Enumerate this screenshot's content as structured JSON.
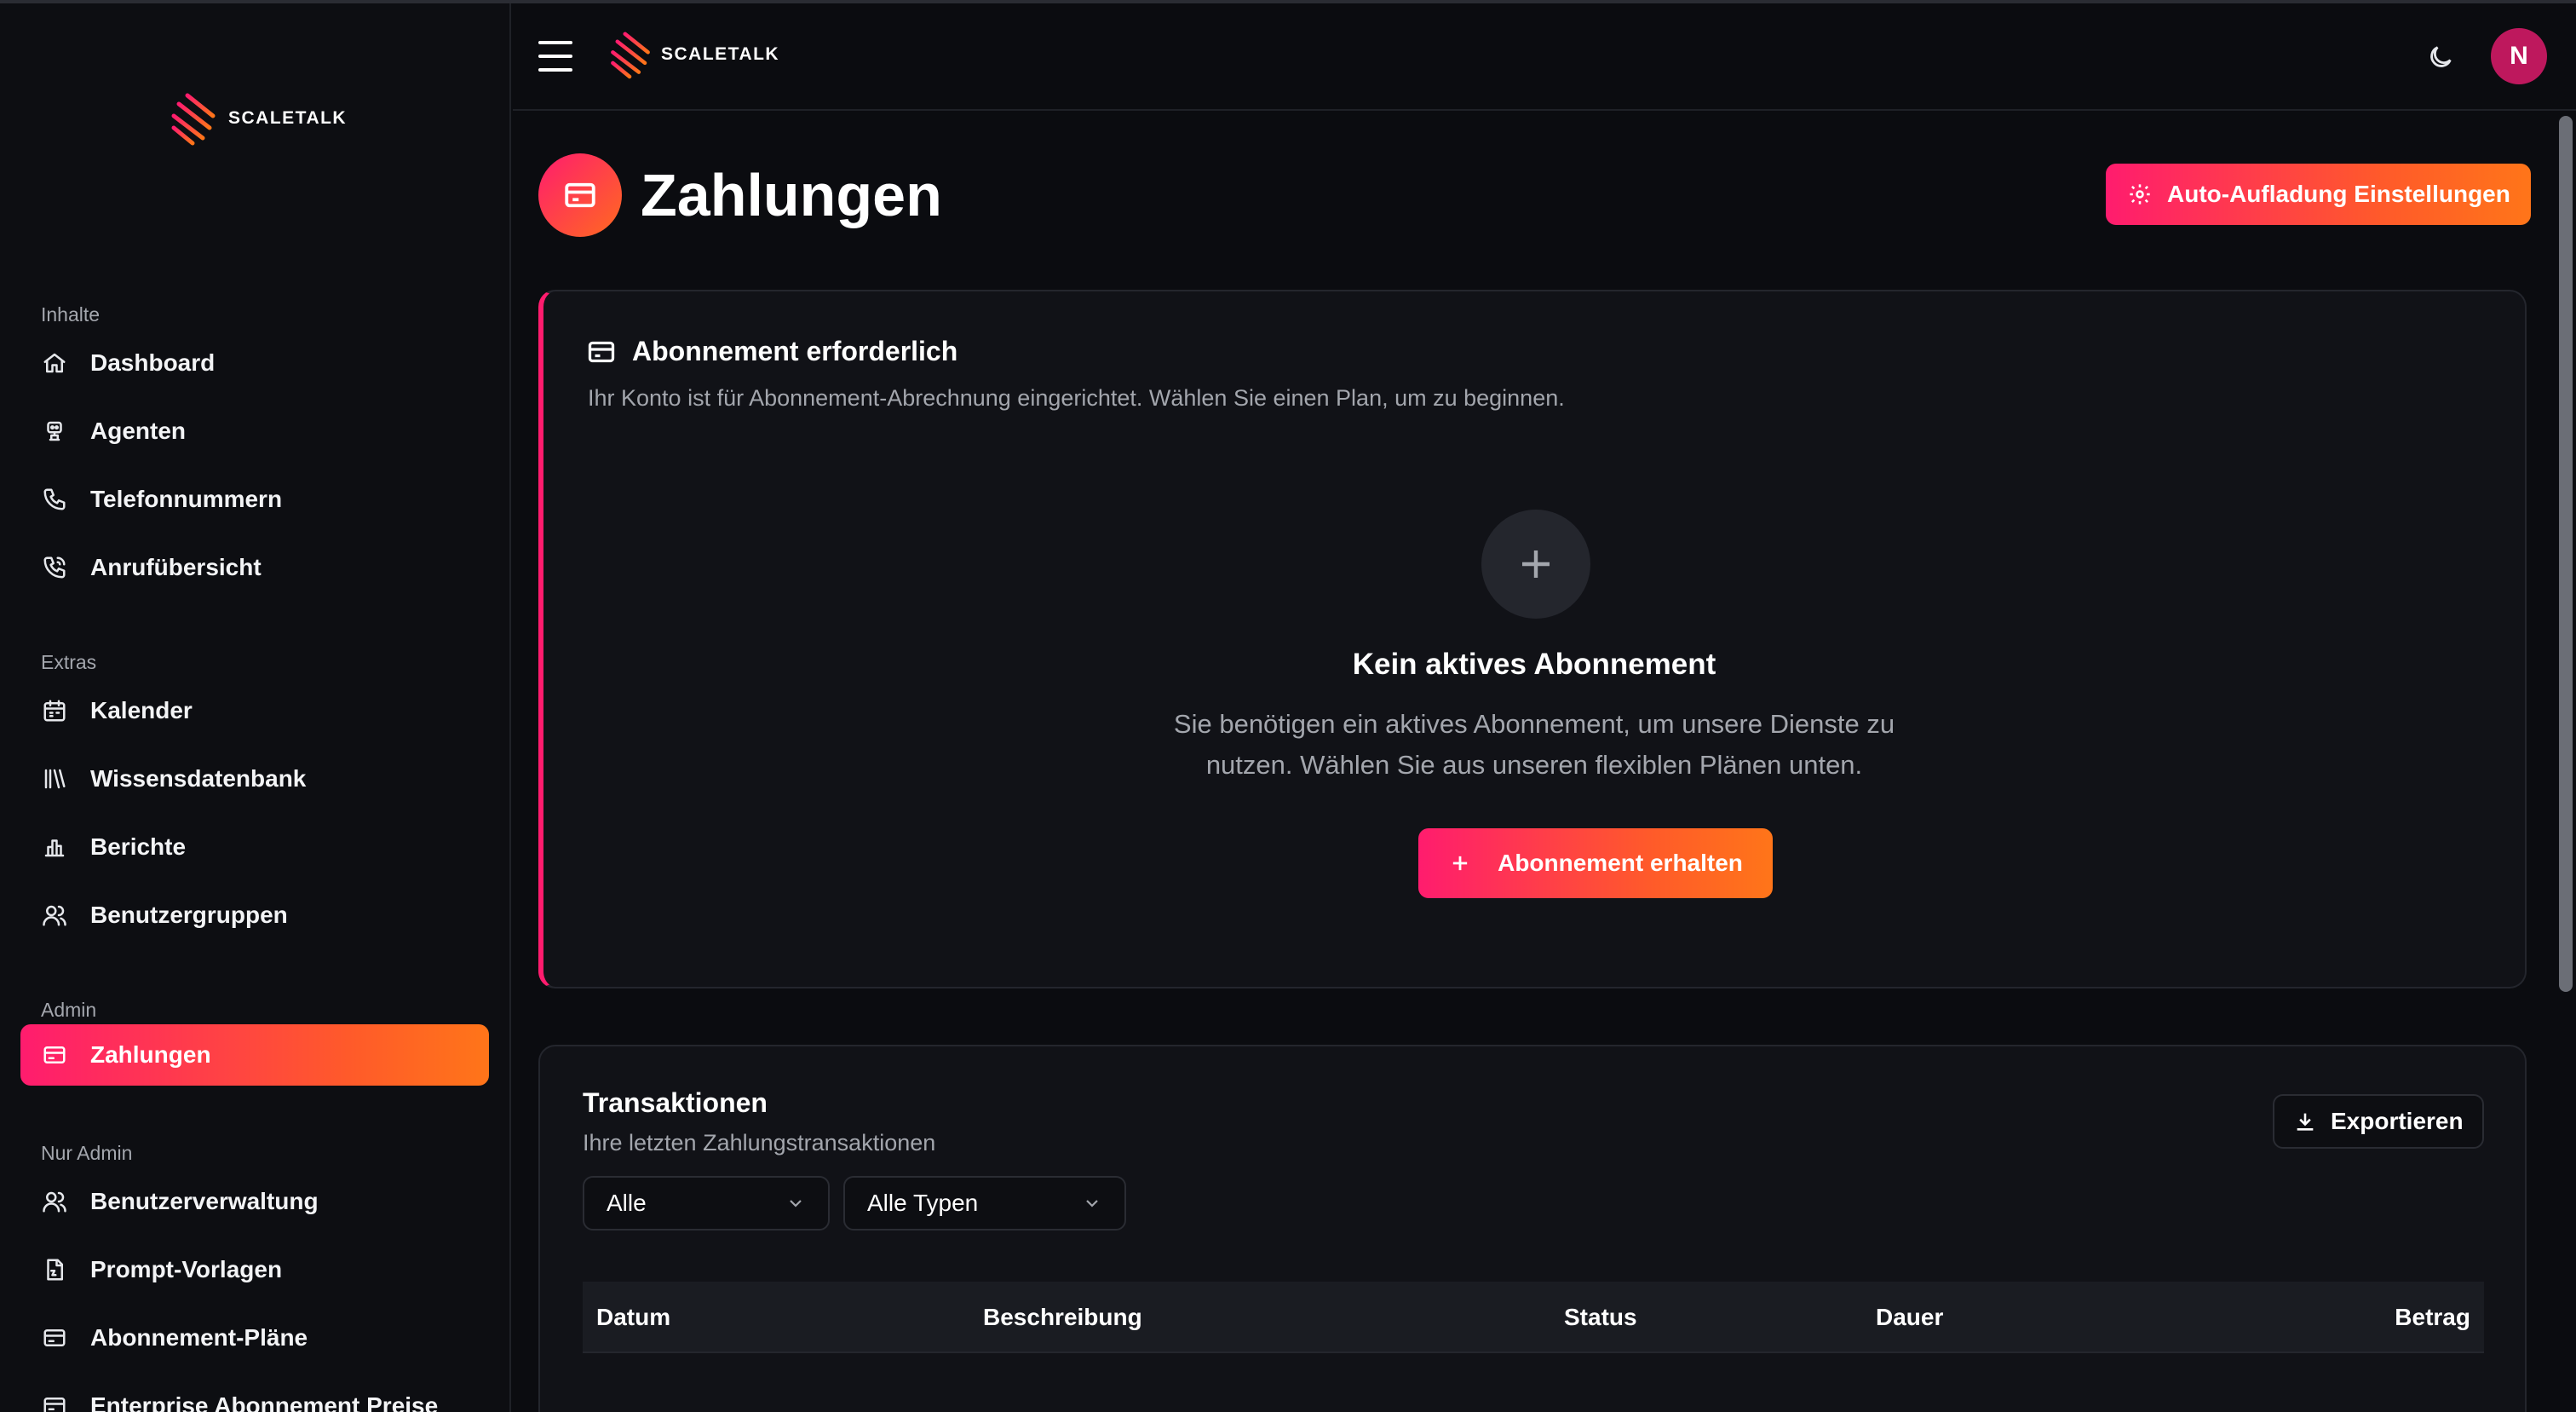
{
  "brand": {
    "name": "SCALETALK"
  },
  "sidebar": {
    "sections": [
      {
        "title": "Inhalte",
        "items": [
          {
            "label": "Dashboard",
            "icon": "home-icon"
          },
          {
            "label": "Agenten",
            "icon": "robot-icon"
          },
          {
            "label": "Telefonnummern",
            "icon": "phone-icon"
          },
          {
            "label": "Anrufübersicht",
            "icon": "phone-call-icon"
          }
        ]
      },
      {
        "title": "Extras",
        "items": [
          {
            "label": "Kalender",
            "icon": "calendar-icon"
          },
          {
            "label": "Wissensdatenbank",
            "icon": "library-icon"
          },
          {
            "label": "Berichte",
            "icon": "bar-chart-icon"
          },
          {
            "label": "Benutzergruppen",
            "icon": "users-icon"
          }
        ]
      },
      {
        "title": "Admin",
        "items": [
          {
            "label": "Zahlungen",
            "icon": "credit-card-icon",
            "active": true
          }
        ]
      },
      {
        "title": "Nur Admin",
        "items": [
          {
            "label": "Benutzerverwaltung",
            "icon": "users-icon"
          },
          {
            "label": "Prompt-Vorlagen",
            "icon": "file-icon"
          },
          {
            "label": "Abonnement-Pläne",
            "icon": "credit-card-icon"
          },
          {
            "label": "Enterprise Abonnement Preise",
            "icon": "credit-card-icon"
          }
        ]
      }
    ]
  },
  "topbar": {
    "avatar_initial": "N"
  },
  "page": {
    "title": "Zahlungen",
    "auto_button": "Auto-Aufladung Einstellungen"
  },
  "subscription": {
    "title": "Abonnement erforderlich",
    "description": "Ihr Konto ist für Abonnement-Abrechnung eingerichtet. Wählen Sie einen Plan, um zu beginnen.",
    "empty_title": "Kein aktives Abonnement",
    "empty_text_line1": "Sie benötigen ein aktives Abonnement, um unsere Dienste zu",
    "empty_text_line2": "nutzen. Wählen Sie aus unseren flexiblen Plänen unten.",
    "cta": "Abonnement erhalten"
  },
  "transactions": {
    "title": "Transaktionen",
    "subtitle": "Ihre letzten Zahlungstransaktionen",
    "export": "Exportieren",
    "filter_status": "Alle",
    "filter_type": "Alle Typen",
    "columns": [
      "Datum",
      "Beschreibung",
      "Status",
      "Dauer",
      "Betrag"
    ]
  },
  "colors": {
    "accent_start": "#ff1c6e",
    "accent_end": "#ff7519",
    "background": "#0b0c10",
    "card": "#111217",
    "avatar": "#be185d"
  }
}
